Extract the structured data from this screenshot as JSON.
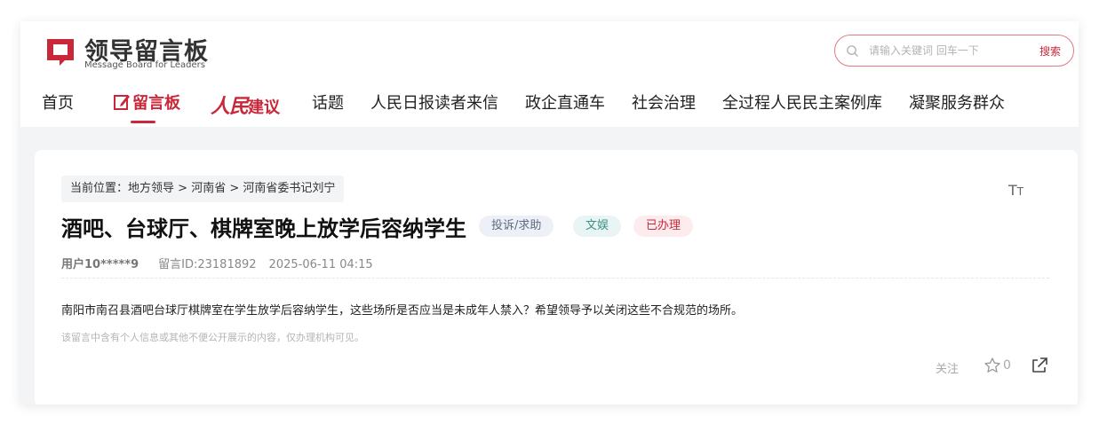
{
  "brand": {
    "name_cn": "领导留言板",
    "name_en": "Message Board for Leaders",
    "accent_color": "#c8283a"
  },
  "search": {
    "placeholder": "请输入关键词 回车一下",
    "button_label": "搜索"
  },
  "nav": {
    "items": [
      {
        "label": "首页"
      },
      {
        "label": "留言板",
        "icon": "note-edit-icon",
        "active": true
      },
      {
        "label_logo": "人民",
        "label": "建议"
      },
      {
        "label": "话题"
      },
      {
        "label": "人民日报读者来信"
      },
      {
        "label": "政企直通车"
      },
      {
        "label": "社会治理"
      },
      {
        "label": "全过程人民民主案例库"
      },
      {
        "label": "凝聚服务群众"
      }
    ]
  },
  "breadcrumb": {
    "prefix": "当前位置：",
    "items": [
      "地方领导",
      "河南省",
      "河南省委书记刘宁"
    ],
    "separator": " > "
  },
  "font_toggle": {
    "large": "T",
    "small": "T"
  },
  "message": {
    "title": "酒吧、台球厅、棋牌室晚上放学后容纳学生",
    "tags": {
      "type": "投诉/求助",
      "domain": "文娱",
      "status": "已办理"
    },
    "user": "用户10*****9",
    "id_label": "留言ID:23181892",
    "datetime": "2025-06-11 04:15",
    "body": "南阳市南召县酒吧台球厅棋牌室在学生放学后容纳学生，这些场所是否应当是未成年人禁入？希望领导予以关闭这些不合规范的场所。",
    "privacy_note": "该留言中含有个人信息或其他不便公开展示的内容，仅办理机构可见。"
  },
  "actions": {
    "follow_label": "关注",
    "like_count": "0",
    "like_icon": "star-icon",
    "share_icon": "share-icon"
  }
}
